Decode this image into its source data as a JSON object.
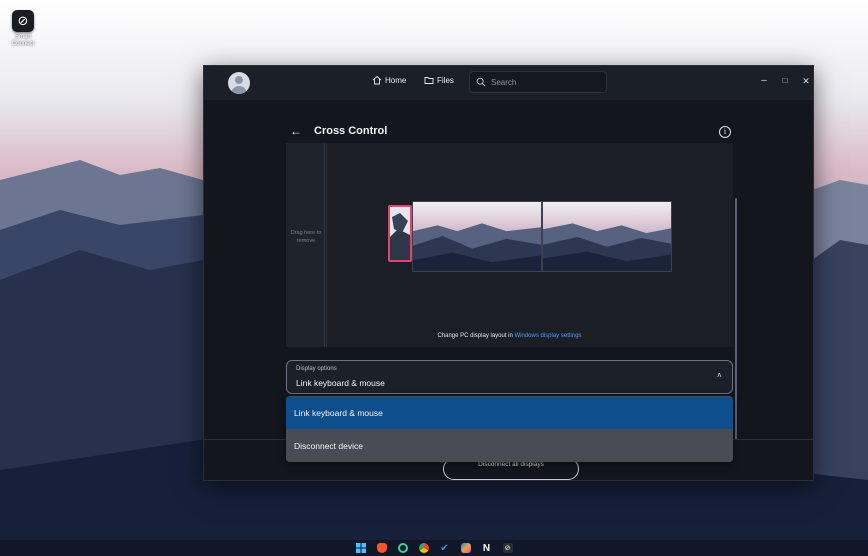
{
  "desktop": {
    "shortcut_label": "Smart Connect"
  },
  "titlebar": {
    "home_label": "Home",
    "files_label": "Files",
    "search_placeholder": "Search",
    "minimize": "–",
    "maximize": "□",
    "close": "✕"
  },
  "page": {
    "back": "←",
    "title": "Cross Control",
    "info": "i"
  },
  "arrange": {
    "drag_hint": "Drag here to remove",
    "layout_hint_prefix": "Change PC display layout in ",
    "layout_hint_link": "Windows display settings"
  },
  "display_options": {
    "caption": "Display options",
    "selected": "Link keyboard & mouse",
    "chevron": "˄",
    "options": [
      {
        "label": "Link keyboard & mouse",
        "selected": true
      },
      {
        "label": "Disconnect device",
        "selected": false
      }
    ]
  },
  "footer": {
    "disconnect_label": "Disconnect all displays"
  },
  "colors": {
    "accent": "#4f9cf7",
    "selected_option": "#0f4e8c",
    "monitor_highlight": "#e0456a"
  },
  "taskbar": {
    "icons": [
      "windows-icon",
      "brave-icon",
      "cortana-icon",
      "chrome-icon",
      "todo-icon",
      "copilot-icon",
      "notion-icon",
      "smart-connect-icon"
    ]
  }
}
